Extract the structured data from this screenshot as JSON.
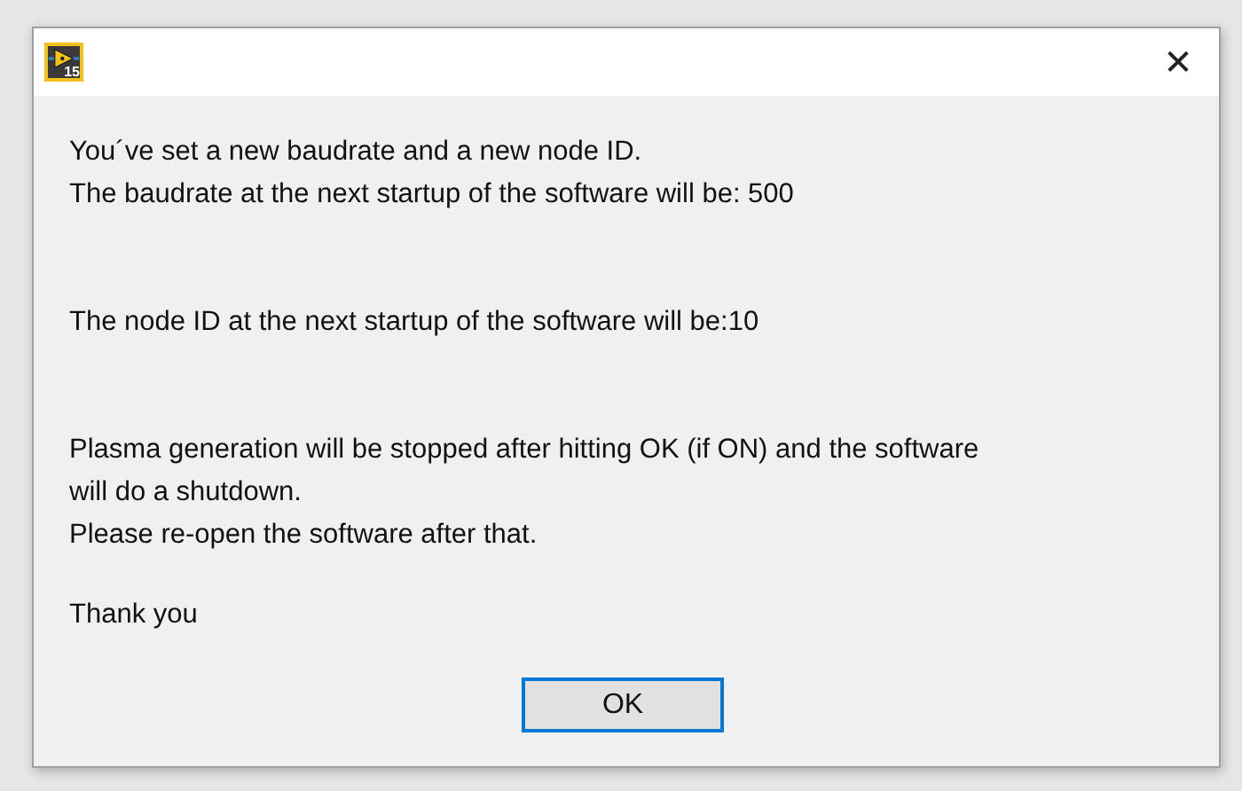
{
  "window": {
    "icon_badge": "15",
    "close": "✕"
  },
  "message": [
    [
      "You´ve set a new baudrate and a new node ID.",
      "The baudrate at the next startup of the software will be: 500"
    ],
    [
      "The node ID at the next startup of the software will be:10"
    ],
    [
      "Plasma generation will be stopped after hitting OK (if ON) and the software",
      "will do a shutdown.",
      "Please re-open the software after that."
    ],
    [
      "Thank you"
    ]
  ],
  "buttons": [
    "OK"
  ]
}
